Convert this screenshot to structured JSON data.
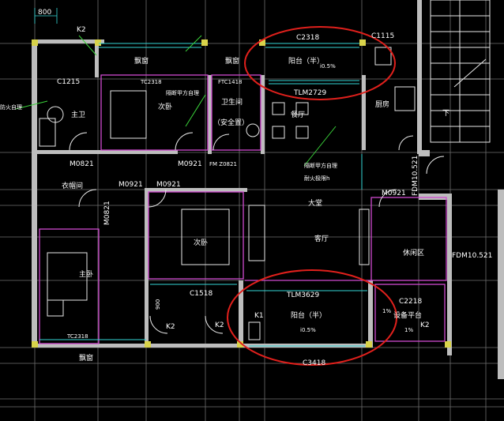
{
  "dimension": "800",
  "window_labels": {
    "c2318_top": "C2318",
    "c1115": "C1115",
    "c1215": "C1215",
    "tc2318_mid": "TC2318",
    "ftc1418": "FTC1418",
    "tlm2729": "TLM2729",
    "tlm3629": "TLM3629",
    "c1518": "C1518",
    "c2218": "C2218",
    "c3418": "C3418",
    "tc2318_low": "TC2318"
  },
  "door_labels": {
    "m0821_a": "M0821",
    "m0921_a": "M0921",
    "fm_z0821": "FM Z0821",
    "m0921_b": "M0921",
    "m0921_c": "M0921",
    "m0821_v": "M0821",
    "m0921_d": "M0921",
    "fdm_right": "FDM10.521",
    "fdm_lower": "FDM10.521"
  },
  "rooms": {
    "bay_window_1": "飘窗",
    "bay_window_2": "飘窗",
    "balcony_top": "阳台（半）",
    "master_bath": "主卫",
    "second_bed": "次卧",
    "bath": "卫生间",
    "safe_room": "（安全置）",
    "dining": "餐厅",
    "kitchen": "厨房",
    "closet": "衣帽间",
    "master_bed": "主卧",
    "second_bed_2": "次卧",
    "living": "客厅",
    "hall": "大堂",
    "leisure": "休闲区",
    "balcony_low": "阳台（半）",
    "equip_platform": "设备平台",
    "bay_window_3": "飘窗",
    "down": "下"
  },
  "notes": {
    "vent_left": "防火自理",
    "vent_mid": "隔断甲方自理",
    "vent_kitchen": "隔断甲方自理",
    "vent_kitchen_2": "耐火极限h"
  },
  "marks": {
    "k2_a": "K2",
    "k2_b": "K2",
    "k2_c": "K2",
    "k2_d": "K2",
    "k1": "K1",
    "h900": "900",
    "slope_1": "i0.5%",
    "slope_2": "i0.5%",
    "slope_3": "1%",
    "slope_4": "1%"
  }
}
